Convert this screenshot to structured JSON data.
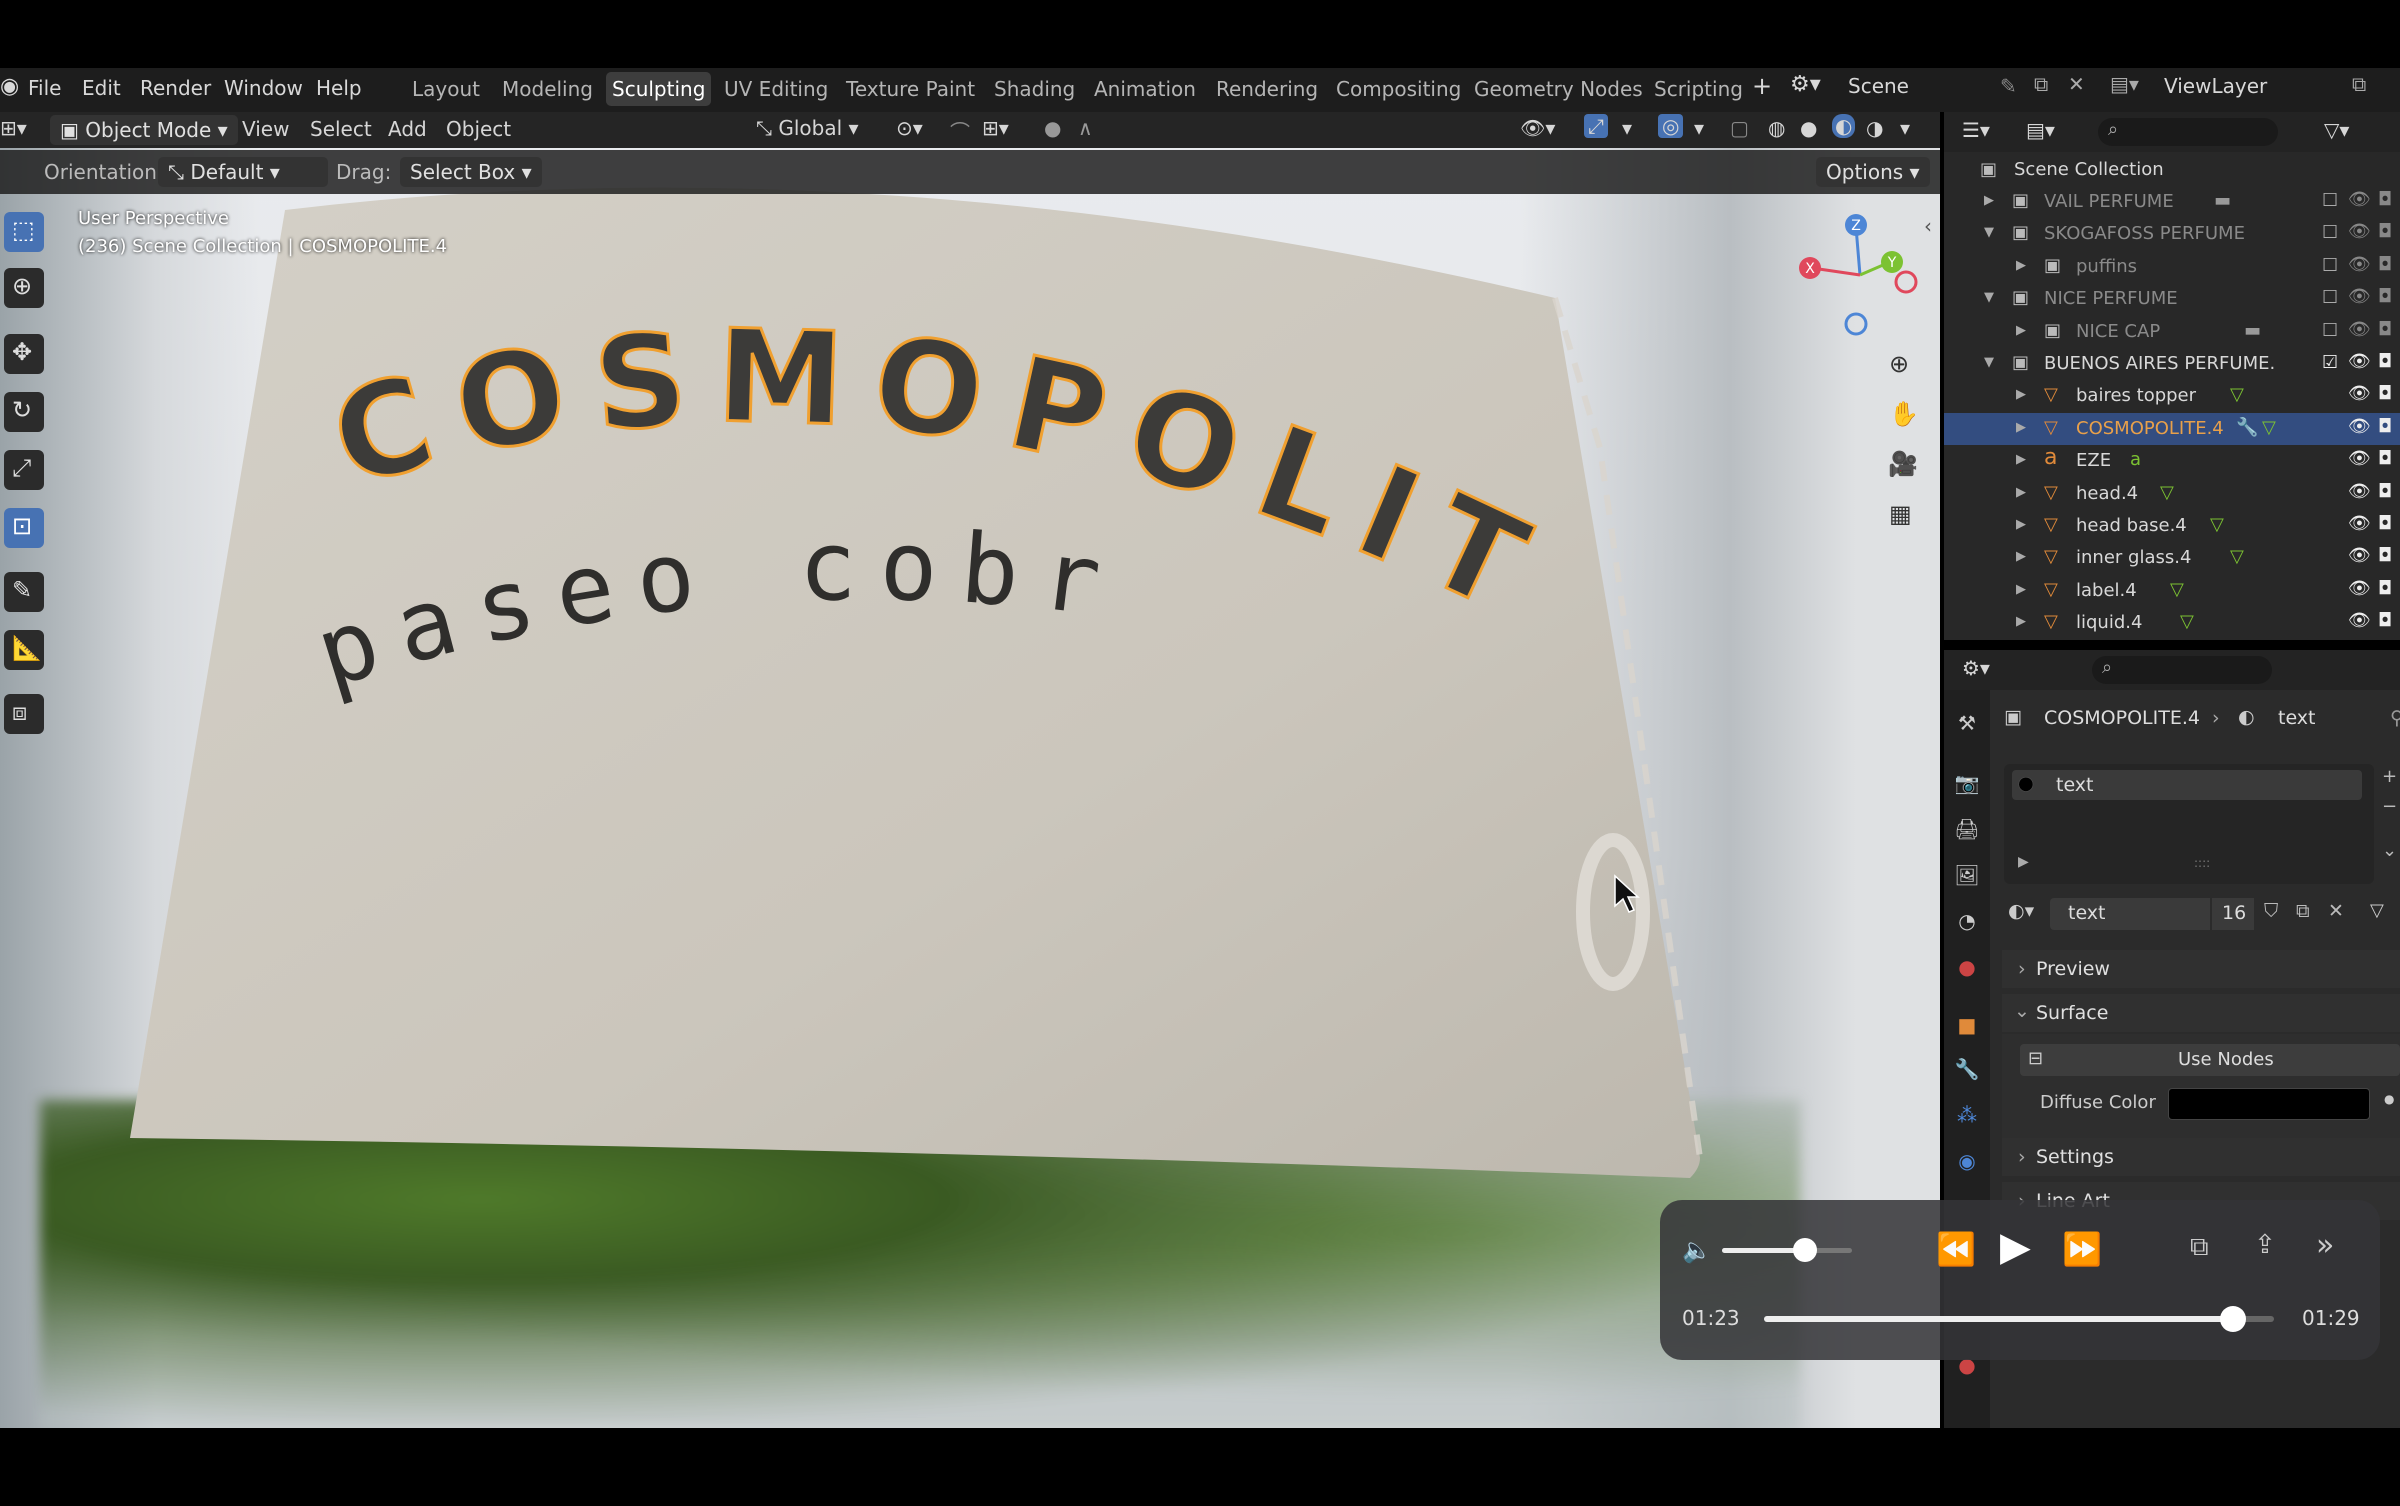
{
  "menubar": {
    "items": [
      "File",
      "Edit",
      "Render",
      "Window",
      "Help"
    ],
    "workspaces": [
      "Layout",
      "Modeling",
      "Sculpting",
      "UV Editing",
      "Texture Paint",
      "Shading",
      "Animation",
      "Rendering",
      "Compositing",
      "Geometry Nodes",
      "Scripting"
    ],
    "active_workspace": "Sculpting",
    "scene": "Scene",
    "view_layer": "ViewLayer"
  },
  "header": {
    "mode": "Object Mode",
    "menus": [
      "View",
      "Select",
      "Add",
      "Object"
    ],
    "transform": "Global",
    "orientation_label": "Orientation:",
    "orientation_value": "Default",
    "drag_label": "Drag:",
    "drag_value": "Select Box",
    "options": "Options"
  },
  "viewport": {
    "perspective": "User Perspective",
    "collection_info": "(236) Scene Collection | COSMOPOLITE.4",
    "label_title": "COSMOPOLITE",
    "label_subtitle": "paseo cobre",
    "gizmo": {
      "x": "X",
      "y": "Y",
      "z": "Z"
    }
  },
  "outliner": {
    "root": "Scene Collection",
    "rows": [
      {
        "label": "VAIL PERFUME",
        "type": "collection",
        "dim": true
      },
      {
        "label": "SKOGAFOSS PERFUME",
        "type": "collection",
        "dim": true
      },
      {
        "label": "puffins",
        "type": "collection",
        "dim": true
      },
      {
        "label": "NICE PERFUME",
        "type": "collection",
        "dim": true
      },
      {
        "label": "NICE CAP",
        "type": "collection",
        "dim": true
      },
      {
        "label": "BUENOS AIRES PERFUME.",
        "type": "collection",
        "dim": false
      },
      {
        "label": "baires topper",
        "type": "mesh",
        "dim": false
      },
      {
        "label": "COSMOPOLITE.4",
        "type": "mesh",
        "dim": false,
        "selected": true
      },
      {
        "label": "EZE",
        "type": "text",
        "dim": false
      },
      {
        "label": "head.4",
        "type": "mesh",
        "dim": false
      },
      {
        "label": "head base.4",
        "type": "mesh",
        "dim": false
      },
      {
        "label": "inner glass.4",
        "type": "mesh",
        "dim": false
      },
      {
        "label": "label.4",
        "type": "mesh",
        "dim": false
      },
      {
        "label": "liquid.4",
        "type": "mesh",
        "dim": false
      }
    ]
  },
  "properties": {
    "object": "COSMOPOLITE.4",
    "material": "text",
    "slot": "text",
    "material_name": "text",
    "users": "16",
    "panels": {
      "preview": "Preview",
      "surface": "Surface",
      "use_nodes": "Use Nodes",
      "diffuse_color_label": "Diffuse Color",
      "settings": "Settings",
      "line_art": "Line Art"
    },
    "diffuse_color": "#000000"
  },
  "video": {
    "current_time": "01:23",
    "total_time": "01:29",
    "progress": 0.92,
    "volume": 0.64
  },
  "colors": {
    "accent": "#4772b3",
    "selection": "#334d80",
    "mesh_icon": "#e08a3a",
    "outline_orange": "#f0a030"
  }
}
